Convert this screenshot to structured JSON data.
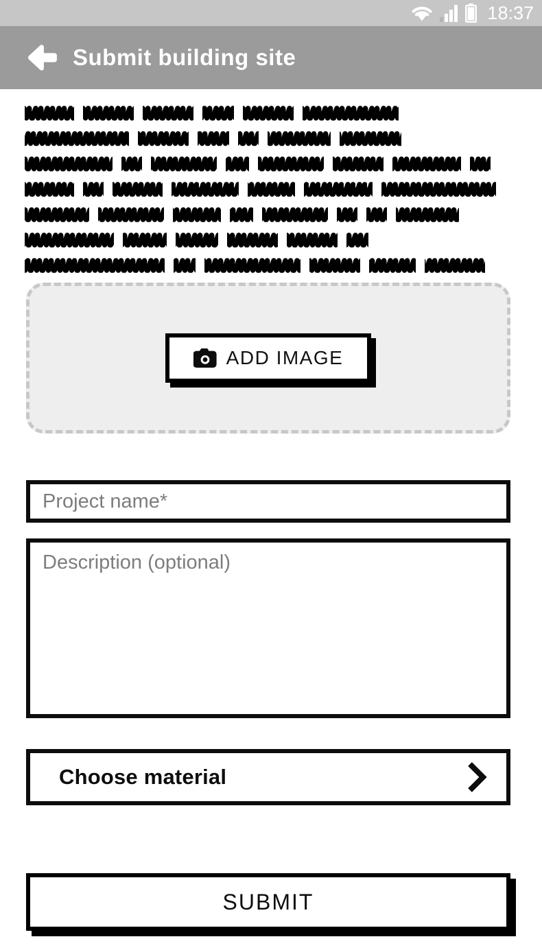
{
  "status_bar": {
    "clock": "18:37",
    "icons": [
      "wifi-icon",
      "cellular-signal-icon",
      "battery-icon"
    ],
    "background_color": "#c6c6c6",
    "foreground_color": "#ffffff"
  },
  "app_bar": {
    "title": "Submit building site",
    "back_icon": "arrow-left-icon",
    "background_color": "#9b9b9b",
    "text_color": "#ffffff"
  },
  "intro_text": {
    "kind": "scribble-placeholder",
    "note": "hand-drawn zig-zag lorem-ipsum strokes, no legible characters",
    "lines": [
      [
        72,
        74,
        74,
        46,
        74,
        140
      ],
      [
        152,
        74,
        46,
        30,
        92,
        90
      ],
      [
        128,
        30,
        96,
        34,
        96,
        74,
        100,
        30
      ],
      [
        72,
        30,
        74,
        98,
        70,
        100,
        168
      ],
      [
        94,
        96,
        70,
        34,
        96,
        30,
        30,
        92
      ],
      [
        130,
        64,
        62,
        74,
        74,
        32
      ],
      [
        204,
        32,
        140,
        74,
        68,
        88
      ]
    ]
  },
  "image_dropzone": {
    "border_style": "dashed",
    "border_color": "#c8c8c8",
    "fill_color": "#eeeeee",
    "button": {
      "label": "ADD IMAGE",
      "icon": "camera-icon"
    }
  },
  "form": {
    "project_name": {
      "placeholder": "Project name*",
      "value": "",
      "required": true
    },
    "description": {
      "placeholder": "Description (optional)",
      "value": "",
      "required": false
    },
    "choose_material": {
      "label": "Choose material",
      "chevron_icon": "chevron-right-icon"
    }
  },
  "submit": {
    "label": "SUBMIT"
  }
}
